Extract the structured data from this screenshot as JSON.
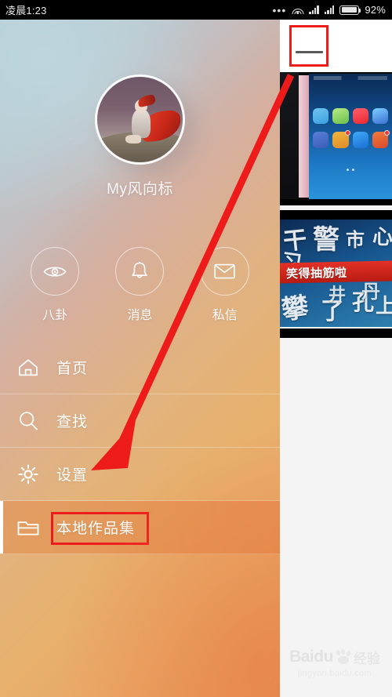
{
  "statusbar": {
    "time": "凌晨1:23",
    "dots": "•••",
    "battery_pct": "92%",
    "icons": [
      "more-dots-icon",
      "wifi-icon",
      "signal-icon",
      "signal-icon",
      "battery-icon"
    ]
  },
  "app": {
    "menu_button": "hamburger-menu-icon",
    "thumbnails": [
      {
        "name": "phone-home-screen-photo",
        "banner_text": ""
      },
      {
        "name": "blue-poster-photo",
        "banner_text": "笑得抽筋啦"
      }
    ],
    "watermark": {
      "brand": "Baidu",
      "suffix": "经验",
      "url": "jingyan.baidu.com"
    }
  },
  "drawer": {
    "profile": {
      "username": "My风向标",
      "avatar": "user-avatar"
    },
    "quick_actions": [
      {
        "label": "八卦",
        "icon": "eye-icon"
      },
      {
        "label": "消息",
        "icon": "bell-icon"
      },
      {
        "label": "私信",
        "icon": "envelope-icon"
      }
    ],
    "menu_items": [
      {
        "label": "首页",
        "icon": "home-icon",
        "active": false
      },
      {
        "label": "查找",
        "icon": "search-icon",
        "active": false
      },
      {
        "label": "设置",
        "icon": "gear-icon",
        "active": false
      },
      {
        "label": "本地作品集",
        "icon": "folder-icon",
        "active": true
      }
    ]
  },
  "annotations": {
    "highlight_color": "#ee1b1b",
    "arrow": {
      "from": "hamburger-menu-icon",
      "to": "本地作品集"
    },
    "boxes": [
      "hamburger-menu-icon",
      "本地作品集"
    ]
  },
  "colors": {
    "accent_red": "#ee1b1b",
    "drawer_top": "#b5cdd6",
    "drawer_bottom": "#e8915 6",
    "app_bg": "#f4f4f4"
  }
}
